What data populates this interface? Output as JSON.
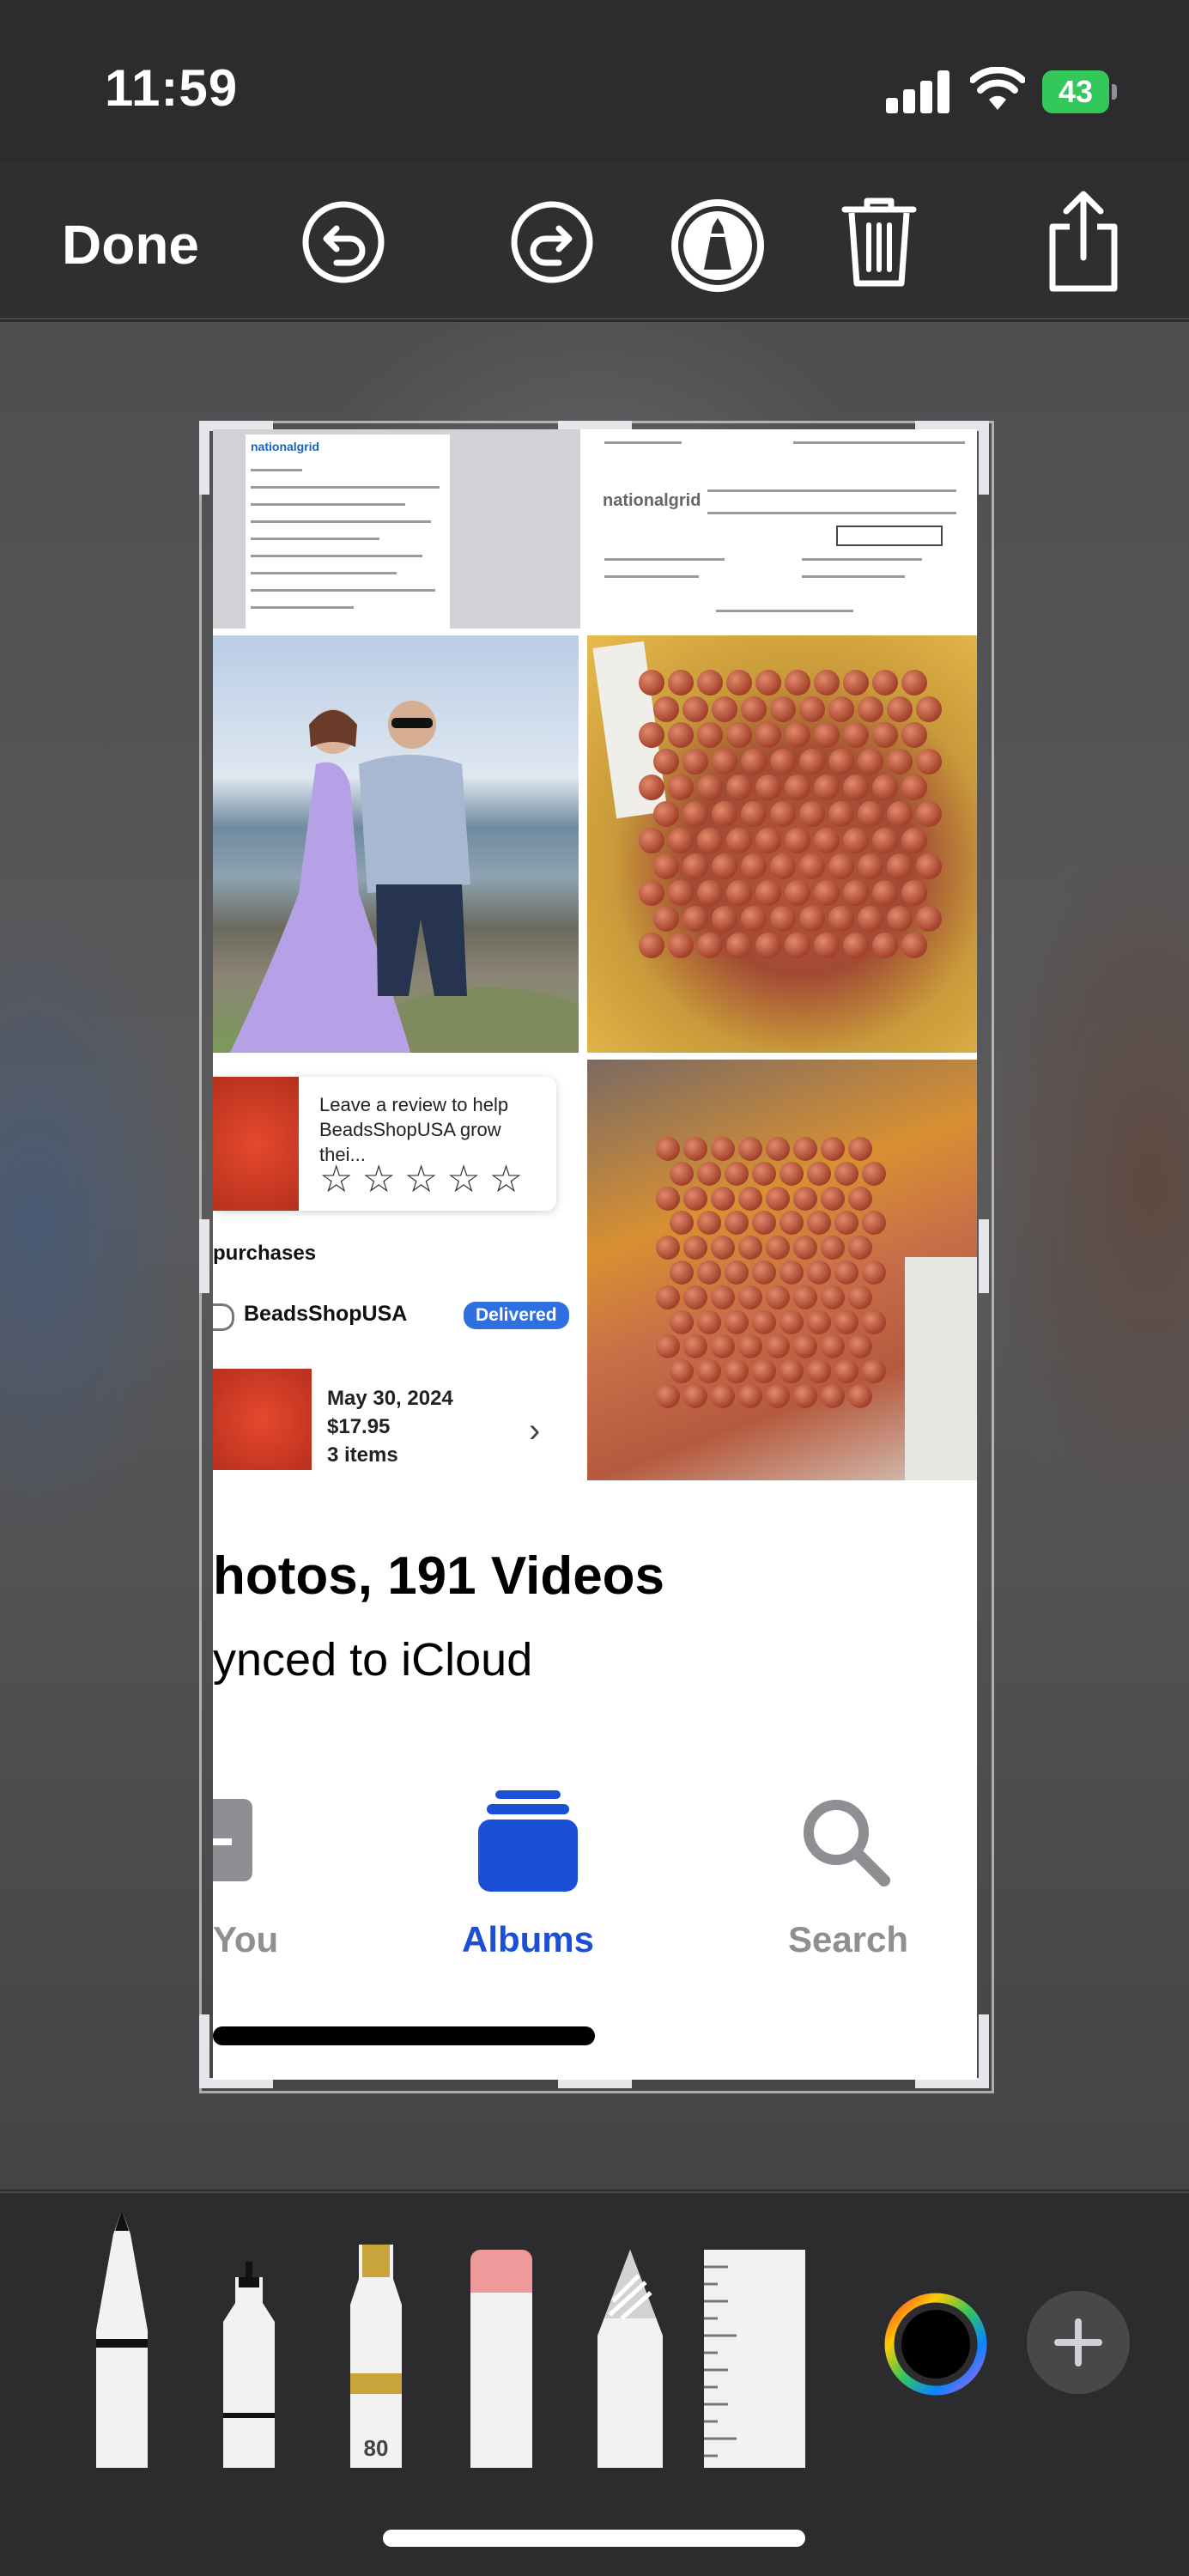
{
  "status_bar": {
    "time": "11:59",
    "battery": "43"
  },
  "toolbar": {
    "done_label": "Done",
    "icons": [
      "undo-icon",
      "redo-icon",
      "markup-icon",
      "trash-icon",
      "share-icon"
    ]
  },
  "screenshot": {
    "bill_brand": "nationalgrid",
    "review_prompt": "Leave a review to help BeadsShopUSA grow thei...",
    "section_heading": "purchases",
    "store_name": "BeadsShopUSA",
    "status_badge": "Delivered",
    "order_date": "May 30, 2024",
    "order_price": "$17.95",
    "order_items": "3 items",
    "library_count": "hotos, 191 Videos",
    "sync_status": "ynced to iCloud",
    "tabs": [
      {
        "label": "You",
        "active": false
      },
      {
        "label": "Albums",
        "active": true
      },
      {
        "label": "Search",
        "active": false
      }
    ]
  },
  "tools": {
    "marker_size": "80",
    "items": [
      "pen-tool",
      "fineliner-tool",
      "marker-tool",
      "eraser-tool",
      "pencil-tool",
      "ruler-tool"
    ],
    "color_picker_color": "#000000",
    "accent_colors": {
      "albums_blue": "#1a4fd6",
      "delivered_blue": "#2f6fe0",
      "battery_green": "#34c759"
    }
  }
}
